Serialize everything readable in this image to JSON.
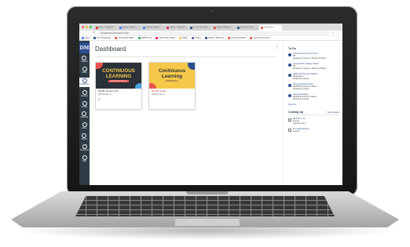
{
  "browser": {
    "tabs": [
      {
        "label": "Mail - Instagram",
        "color": "#d93025"
      },
      {
        "label": "laptop images",
        "color": "#4285f4"
      },
      {
        "label": "Laptop images",
        "color": "#4285f4"
      },
      {
        "label": "Padlet - Webinar",
        "color": "#e91e63"
      },
      {
        "label": "PD Virtual Learn",
        "color": "#2c4f8c"
      },
      {
        "label": "Quick Guides to",
        "color": "#e8554e"
      },
      {
        "label": "MS Admin Ser",
        "color": "#2c4f8c"
      },
      {
        "label": "Dashboard",
        "color": "#e8554e"
      }
    ],
    "active_tab": 7,
    "url": "dmschools.instructure.com",
    "bookmarks": [
      "Apps",
      "Infor Integration",
      "Schoolwide REAL",
      "DMPS Intra",
      "Iowa Public Radio",
      "Slides",
      "Teams",
      "Teacher Directory",
      "Canvas Modules",
      "Canvas Help Form"
    ],
    "bookmark_colors": [
      "#4285f4",
      "#2c4f8c",
      "#e8554e",
      "#34a853",
      "#e91e63",
      "#f6c84a",
      "#5b5fc7",
      "#2c4f8c",
      "#e8554e",
      "#e8554e"
    ]
  },
  "global_nav": {
    "logo": "DM",
    "items": [
      {
        "label": "Account",
        "active": false
      },
      {
        "label": "Admin",
        "active": false
      },
      {
        "label": "Dashboard",
        "active": true
      },
      {
        "label": "Courses",
        "active": false
      },
      {
        "label": "Groups",
        "active": false
      },
      {
        "label": "Calendar",
        "active": false
      },
      {
        "label": "Inbox",
        "active": false
      },
      {
        "label": "History",
        "active": false
      },
      {
        "label": "Commons",
        "active": false
      },
      {
        "label": "Help",
        "active": false
      }
    ]
  },
  "dashboard": {
    "title": "Dashboard",
    "cards": [
      {
        "hero_title": "CONTINUOUS LEARNING",
        "hero_sub": "www.dmschools.org",
        "name": "Middle School & ID",
        "term": "DMPSplatform",
        "style": "dark"
      },
      {
        "hero_title": "Continuous Learning",
        "hero_sub": "DMPSplatform",
        "name": "PK-5th Grade",
        "term": "DMPSplatform",
        "style": "yellow"
      }
    ]
  },
  "sidebar": {
    "todo_heading": "To Do",
    "todos": [
      {
        "title": "Schedule Summer '20 Hours",
        "lines": [
          "PD",
          "Required by Aug 15, 2020 at 11:59pm"
        ]
      },
      {
        "title": "Canvas Web Grading Tutorial",
        "lines": [
          "PD",
          "Required by Aug 15, 2020 at 11:59pm"
        ]
      },
      {
        "title": "DMPS PD Summer Platform",
        "lines": [
          "Registration",
          "Required by Aug 1"
        ]
      },
      {
        "title": "Canvas Webinar Series",
        "lines": [
          "DMPSPD Summer Institute",
          "Required by Aug 1"
        ]
      },
      {
        "title": "Canvas Guidance",
        "lines": [
          "DMPSPD Summer Institute",
          "Required by Aug 1"
        ]
      }
    ],
    "show_all": "Show All",
    "coming_heading": "Coming Up",
    "coming_link": "View Calendar",
    "coming": [
      {
        "title": "PD-5th Gr. 14",
        "lines": [
          "Aug 20",
          "Aug 20 at 1pm"
        ]
      },
      {
        "title": "PD Guide Meeting",
        "lines": [
          "Aug 22"
        ]
      }
    ]
  }
}
